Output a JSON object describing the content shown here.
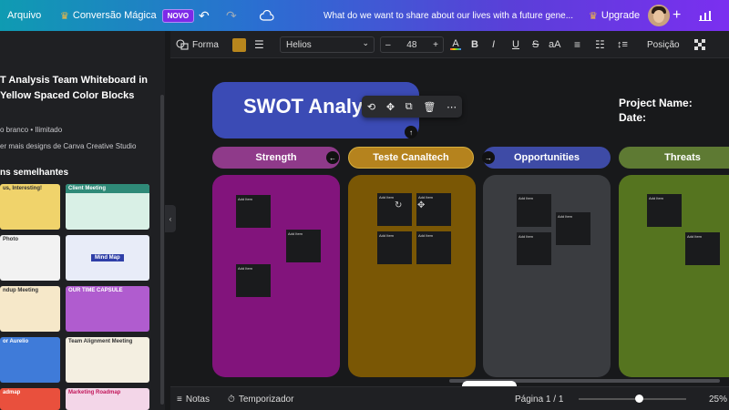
{
  "topbar": {
    "arquivo": "Arquivo",
    "conversao": "Conversão Mágica",
    "novo": "NOVO",
    "doc_title": "What do we want to share about our lives with a future gene...",
    "upgrade": "Upgrade",
    "plus": "+"
  },
  "left_panel": {
    "title": "T Analysis Team Whiteboard in Yellow Spaced Color Blocks",
    "meta1": "o branco • Ilimitado",
    "meta2": "er mais designs de Canva Creative Studio",
    "similar": "ns semelhantes",
    "thumbs": [
      {
        "label": "us, Interesting!",
        "color": "#f0d36b"
      },
      {
        "label": "Client Meeting",
        "color": "#d9f0e6"
      },
      {
        "label": "Photo",
        "color": "#f2f2f2"
      },
      {
        "label": "Mind Map",
        "color": "#e8ecf8"
      },
      {
        "label": "ndup Meeting",
        "color": "#f6e8c9"
      },
      {
        "label": "OUR TIME CAPSULE",
        "color": "#b05ccf"
      },
      {
        "label": "or Aurelio",
        "color": "#3f7bd9"
      },
      {
        "label": "Team Alignment Meeting",
        "color": "#f4efe1"
      },
      {
        "label": "admap",
        "color": "#e9503d"
      },
      {
        "label": "Marketing Roadmap",
        "color": "#f3d6e8"
      }
    ]
  },
  "toolbar": {
    "forma": "Forma",
    "font": "Helios",
    "size_minus": "–",
    "size": "48",
    "size_plus": "+",
    "bold": "B",
    "italic": "I",
    "underline": "U",
    "strike": "S",
    "case": "aA",
    "posicao": "Posição",
    "swatch_color": "#b8861d"
  },
  "canvas": {
    "title": "SWOT Analy",
    "project_name": "Project Name:",
    "date": "Date:",
    "columns": [
      {
        "header": "Strength",
        "hdr_color": "#8f3a8a",
        "col_color": "#82147c"
      },
      {
        "header": "Teste Canaltech",
        "hdr_color": "#b5831e",
        "col_color": "#7a5705"
      },
      {
        "header": "Opportunities",
        "hdr_color": "#3e4ba6",
        "col_color": "#3a3c40"
      },
      {
        "header": "Threats",
        "hdr_color": "#5e7a33",
        "col_color": "#55741f"
      }
    ],
    "note_text": "Add Item"
  },
  "bottombar": {
    "notas": "Notas",
    "temporizador": "Temporizador",
    "pagina": "Página 1 / 1",
    "zoom": "25%",
    "zoom_level": 0.25
  }
}
